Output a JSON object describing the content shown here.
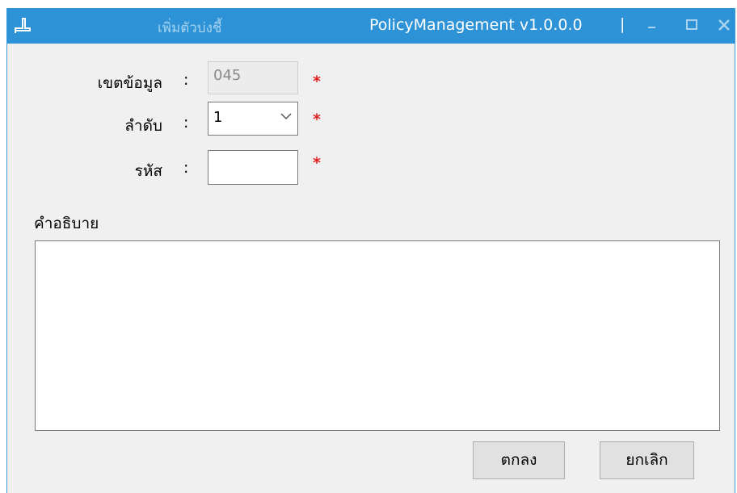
{
  "window": {
    "title": "เพิ่มตัวบ่งชี้",
    "app_name": "PolicyManagement v1.0.0.0",
    "separator": "|",
    "accent_color": "#2d93d6",
    "controls": {
      "minimize_icon": "minimize-icon",
      "maximize_icon": "maximize-icon",
      "close_icon": "close-icon"
    }
  },
  "form": {
    "colon": ":",
    "required_mark": "*",
    "data_scope": {
      "label": "เขตข้อมูล",
      "value": "045",
      "disabled": true
    },
    "order": {
      "label": "ลำดับ",
      "selected": "1"
    },
    "code": {
      "label": "รหัส",
      "value": ""
    },
    "description": {
      "label": "คำอธิบาย",
      "value": ""
    }
  },
  "buttons": {
    "ok_label": "ตกลง",
    "cancel_label": "ยกเลิก"
  }
}
